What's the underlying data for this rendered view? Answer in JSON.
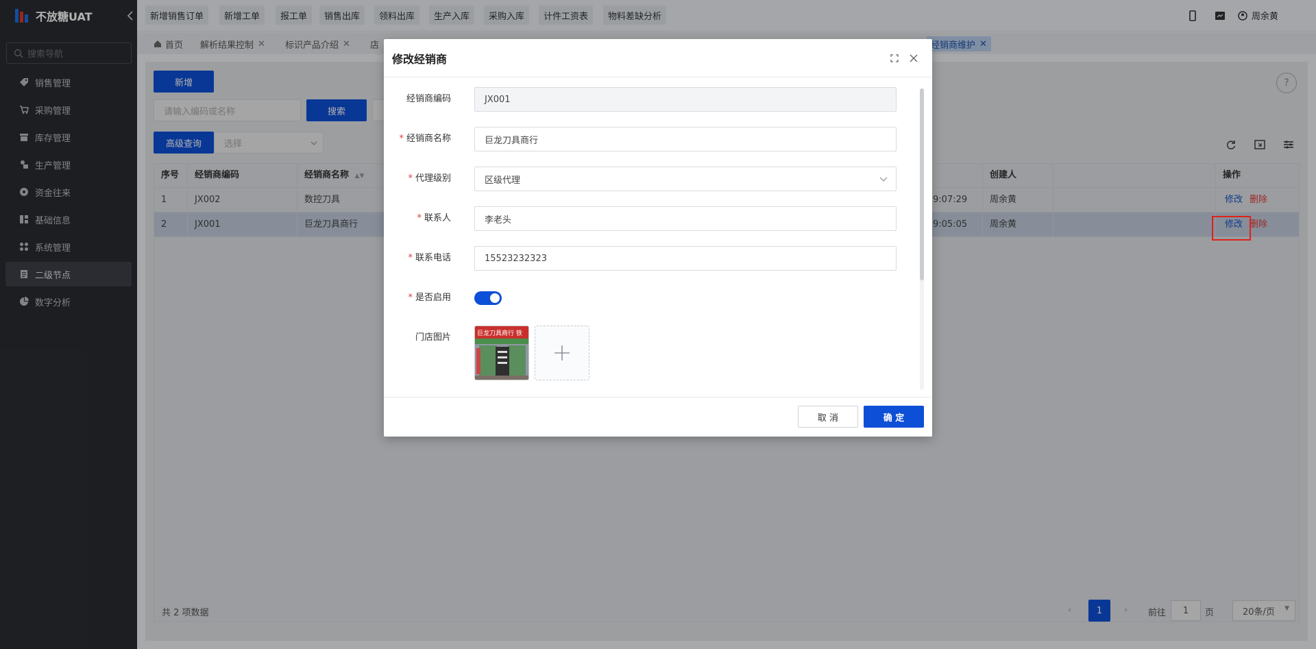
{
  "app": {
    "name": "不放糖UAT"
  },
  "sidebar": {
    "search_placeholder": "搜索导航",
    "items": [
      {
        "label": "销售管理",
        "icon": "tag-icon"
      },
      {
        "label": "采购管理",
        "icon": "cart-icon"
      },
      {
        "label": "库存管理",
        "icon": "box-icon"
      },
      {
        "label": "生产管理",
        "icon": "factory-icon"
      },
      {
        "label": "资金往来",
        "icon": "coin-icon"
      },
      {
        "label": "基础信息",
        "icon": "grid-icon"
      },
      {
        "label": "系统管理",
        "icon": "apps-icon"
      },
      {
        "label": "二级节点",
        "icon": "document-icon"
      },
      {
        "label": "数字分析",
        "icon": "pie-icon"
      }
    ]
  },
  "topbar": {
    "quick_links": [
      "新增销售订单",
      "新增工单",
      "报工单",
      "销售出库",
      "领料出库",
      "生产入库",
      "采购入库",
      "计件工资表",
      "物料差缺分析"
    ],
    "user": "周余黄"
  },
  "tabs": [
    {
      "label": "首页"
    },
    {
      "label": "解析结果控制"
    },
    {
      "label": "标识产品介绍"
    },
    {
      "label": "店"
    },
    {
      "label": "经销商维护"
    }
  ],
  "toolbar": {
    "add_label": "新增",
    "search_placeholder": "请输入编码或名称",
    "search_label": "搜索",
    "advanced_label": "高级查询",
    "select_placeholder": "选择"
  },
  "table": {
    "headers": [
      "序号",
      "经销商编码",
      "经销商名称",
      "创建人",
      "操作"
    ],
    "rows": [
      {
        "index": "1",
        "code": "JX002",
        "name": "数控刀具",
        "time": "9:07:29",
        "creator": "周余黄",
        "edit": "修改",
        "delete": "删除"
      },
      {
        "index": "2",
        "code": "JX001",
        "name": "巨龙刀具商行",
        "time": "9:05:05",
        "creator": "周余黄",
        "edit": "修改",
        "delete": "删除"
      }
    ]
  },
  "pagination": {
    "total": "共 2 项数据",
    "current_page": "1",
    "goto_label": "前往",
    "goto_value": "1",
    "page_suffix": "页",
    "page_size": "20条/页"
  },
  "modal": {
    "title": "修改经销商",
    "fields": {
      "code": {
        "label": "经销商编码",
        "value": "JX001"
      },
      "name": {
        "label": "经销商名称",
        "value": "巨龙刀具商行"
      },
      "level": {
        "label": "代理级别",
        "value": "区级代理"
      },
      "contact": {
        "label": "联系人",
        "value": "李老头"
      },
      "phone": {
        "label": "联系电话",
        "value": "15523232323"
      },
      "enabled": {
        "label": "是否启用",
        "value": true
      },
      "photo": {
        "label": "门店图片",
        "sign_text": "巨龙刀具商行 铁"
      }
    },
    "cancel_label": "取 消",
    "ok_label": "确 定"
  },
  "colors": {
    "primary": "#0d4fd6",
    "danger": "#e03a3a",
    "sidebar_bg": "#2a2c30",
    "highlight_box": "#e0201a"
  }
}
